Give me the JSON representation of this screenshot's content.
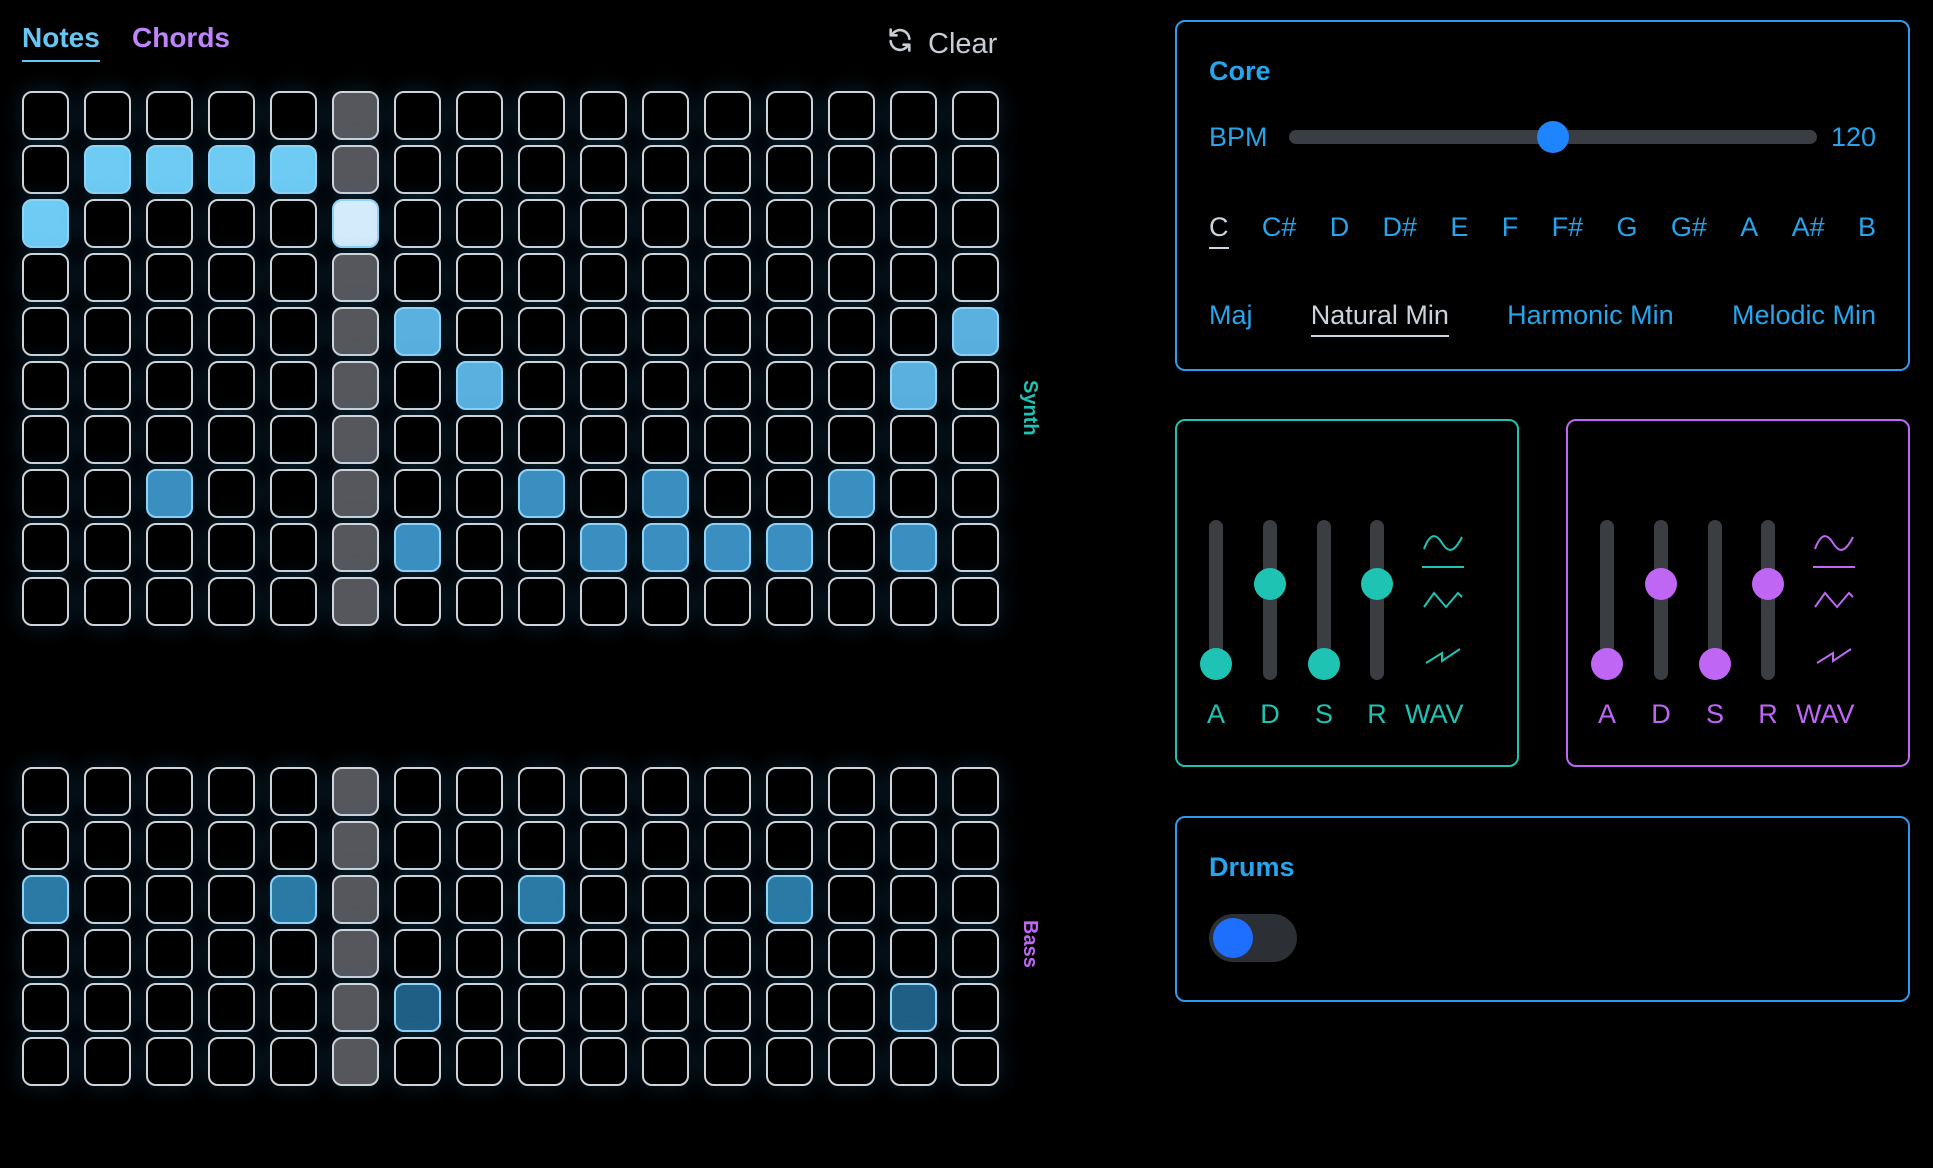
{
  "tabs": {
    "notes": "Notes",
    "chords": "Chords"
  },
  "clear_label": "Clear",
  "synth_side_label": "Synth",
  "bass_side_label": "Bass",
  "grid": {
    "columns": 16,
    "playhead_column": 5,
    "synth_rows": [
      [],
      [
        1,
        2,
        3,
        4
      ],
      [
        0,
        5
      ],
      [],
      [
        6,
        15
      ],
      [
        7,
        14
      ],
      [],
      [
        2,
        8,
        10,
        13
      ],
      [
        6,
        9,
        10,
        11,
        12,
        14
      ],
      []
    ],
    "bass_rows": [
      [],
      [],
      [
        0,
        4,
        8,
        12
      ],
      [],
      [
        6,
        14
      ],
      []
    ],
    "colors": {
      "bright": "#6ecbf3",
      "mid": "#5ab0de",
      "dim": "#3b8fc0",
      "bass": "#2a7aa5",
      "bass_dark": "#1f5f85",
      "highlight": "#d4ebfb"
    }
  },
  "core": {
    "title": "Core",
    "bpm_label": "BPM",
    "bpm_value": "120",
    "bpm_fraction": 0.5,
    "keys": [
      "C",
      "C#",
      "D",
      "D#",
      "E",
      "F",
      "F#",
      "G",
      "G#",
      "A",
      "A#",
      "B"
    ],
    "selected_key": "C",
    "scales": [
      "Maj",
      "Natural Min",
      "Harmonic Min",
      "Melodic Min"
    ],
    "selected_scale": "Natural Min"
  },
  "synth": {
    "title": "Synth",
    "color": "#1fc3b4",
    "adsr_labels": [
      "A",
      "D",
      "S",
      "R"
    ],
    "adsr_values": [
      0.1,
      0.6,
      0.1,
      0.6
    ],
    "wav_label": "WAV",
    "waves": [
      "sine-icon",
      "triangle-icon",
      "sawtooth-icon"
    ],
    "selected_wave": "sine-icon"
  },
  "bass": {
    "title": "Bass",
    "color": "#c066f5",
    "adsr_labels": [
      "A",
      "D",
      "S",
      "R"
    ],
    "adsr_values": [
      0.1,
      0.6,
      0.1,
      0.6
    ],
    "wav_label": "WAV",
    "waves": [
      "sine-icon",
      "triangle-icon",
      "sawtooth-icon"
    ],
    "selected_wave": "sine-icon"
  },
  "drums": {
    "title": "Drums",
    "enabled": true
  }
}
